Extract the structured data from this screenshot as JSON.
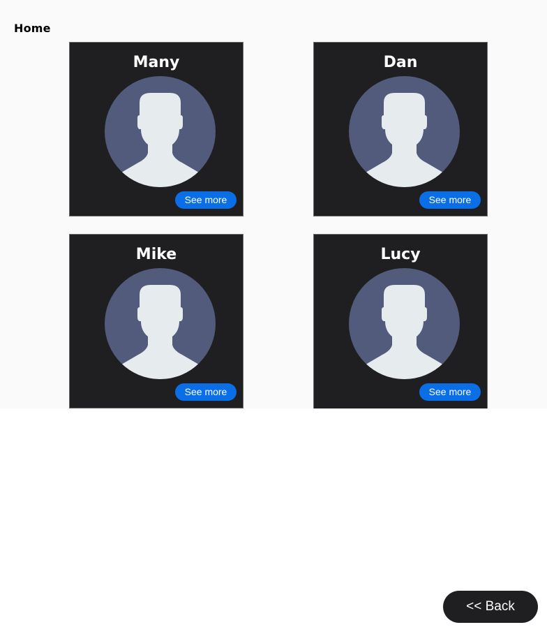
{
  "nav": {
    "home_label": "Home"
  },
  "profiles": [
    {
      "name": "Many",
      "button_label": "See more"
    },
    {
      "name": "Dan",
      "button_label": "See more"
    },
    {
      "name": "Mike",
      "button_label": "See more"
    },
    {
      "name": "Lucy",
      "button_label": "See more"
    }
  ],
  "footer": {
    "back_label": "<< Back"
  },
  "icons": {
    "avatar": "default-user-avatar-icon"
  },
  "colors": {
    "card_background": "#1f1f21",
    "avatar_background": "#525b7c",
    "avatar_silhouette": "#e6ecee",
    "accent_button": "#0a6fe6",
    "page_background": "#fafafa"
  }
}
